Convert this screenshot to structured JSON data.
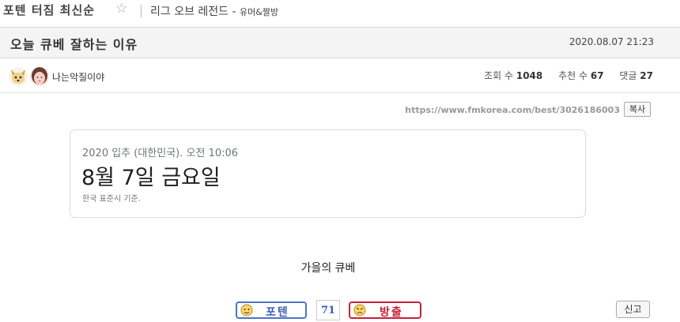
{
  "board": {
    "title": "포텐 터짐 최신순",
    "category": "리그 오브 레전드",
    "category_sep": " - ",
    "subcategory": "유머&짤방"
  },
  "post": {
    "title": "오늘 큐베 잘하는 이유",
    "date": "2020.08.07 21:23",
    "author": "나는악질이야"
  },
  "stats": {
    "views_label": "조회 수",
    "views": "1048",
    "likes_label": "추천 수",
    "likes": "67",
    "comments_label": "댓글",
    "comments": "27"
  },
  "share": {
    "url": "https://www.fmkorea.com/best/3026186003",
    "copy_label": "복사"
  },
  "card": {
    "line1": "2020 입추 (대한민국). 오전 10:06",
    "date": "8월 7일 금요일",
    "note": "한국 표준시 기준."
  },
  "content": {
    "text": "가을의 큐베"
  },
  "votes": {
    "up_label": "포텐",
    "count": "71",
    "down_label": "방출"
  },
  "report": {
    "label": "신고"
  },
  "colors": {
    "accent_blue": "#3a5fb8",
    "accent_red": "#c9203a"
  },
  "icons": {
    "favorite": "star-outline-icon"
  }
}
